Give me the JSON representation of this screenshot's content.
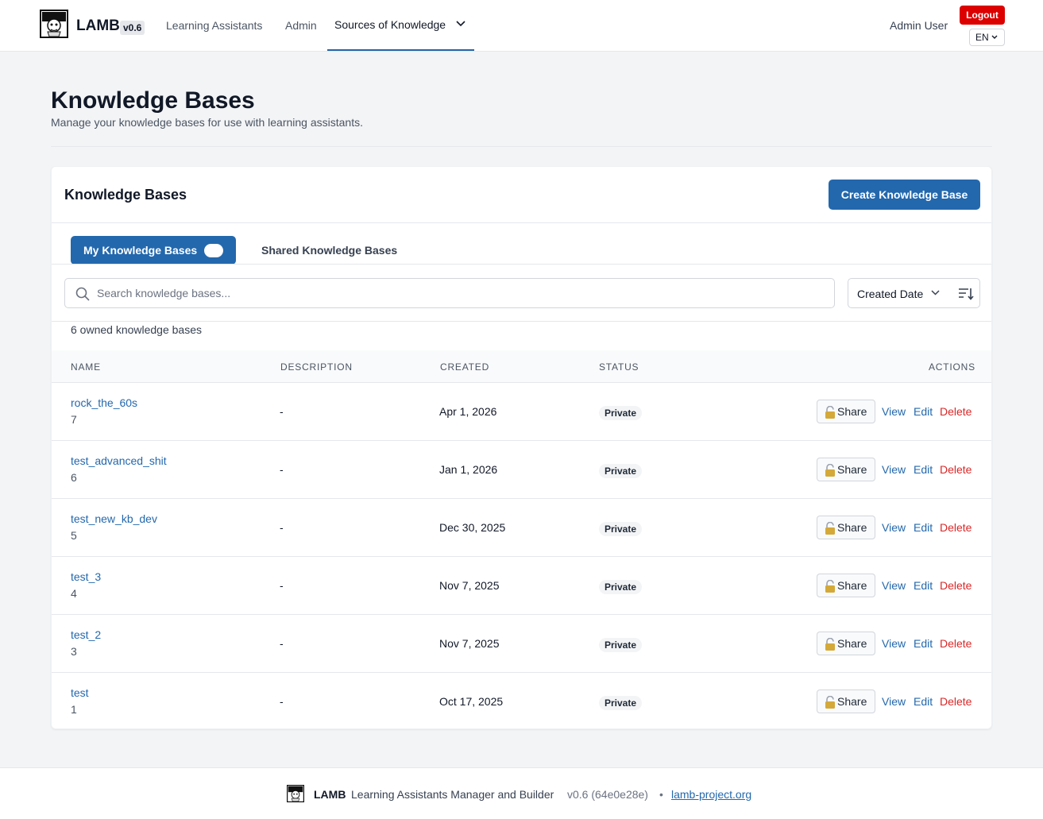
{
  "header": {
    "brand": "LAMB",
    "version": "v0.6",
    "nav": [
      {
        "label": "Learning Assistants"
      },
      {
        "label": "Admin"
      },
      {
        "label": "Sources of Knowledge"
      }
    ],
    "user_name": "Admin User",
    "logout_label": "Logout",
    "language": "EN"
  },
  "page": {
    "title": "Knowledge Bases",
    "subtitle": "Manage your knowledge bases for use with learning assistants."
  },
  "card": {
    "title": "Knowledge Bases",
    "create_label": "Create Knowledge Base",
    "tabs": [
      {
        "label": "My Knowledge Bases",
        "active": true
      },
      {
        "label": "Shared Knowledge Bases",
        "active": false
      }
    ],
    "search": {
      "placeholder": "Search knowledge bases...",
      "value": ""
    },
    "sort": {
      "selected": "Created Date"
    },
    "count_text": "6 owned knowledge bases"
  },
  "table": {
    "columns": [
      "NAME",
      "DESCRIPTION",
      "CREATED",
      "STATUS",
      "ACTIONS"
    ],
    "actions": {
      "share": "Share",
      "view": "View",
      "edit": "Edit",
      "delete": "Delete"
    },
    "rows": [
      {
        "name": "rock_the_60s",
        "id": "7",
        "description": "-",
        "created": "Apr 1, 2026",
        "status": "Private"
      },
      {
        "name": "test_advanced_shit",
        "id": "6",
        "description": "-",
        "created": "Jan 1, 2026",
        "status": "Private"
      },
      {
        "name": "test_new_kb_dev",
        "id": "5",
        "description": "-",
        "created": "Dec 30, 2025",
        "status": "Private"
      },
      {
        "name": "test_3",
        "id": "4",
        "description": "-",
        "created": "Nov 7, 2025",
        "status": "Private"
      },
      {
        "name": "test_2",
        "id": "3",
        "description": "-",
        "created": "Nov 7, 2025",
        "status": "Private"
      },
      {
        "name": "test",
        "id": "1",
        "description": "-",
        "created": "Oct 17, 2025",
        "status": "Private"
      }
    ]
  },
  "footer": {
    "brand": "LAMB",
    "description": "Learning Assistants Manager and Builder",
    "version": "v0.6 (64e0e28e)",
    "separator": "•",
    "link": "lamb-project.org"
  },
  "colors": {
    "primary": "#2368ad",
    "danger": "#dc2626",
    "logout": "#dc0000"
  },
  "icons": [
    "lamb-logo-icon",
    "chevron-down-icon",
    "search-icon",
    "sort-direction-icon",
    "lock-icon"
  ]
}
